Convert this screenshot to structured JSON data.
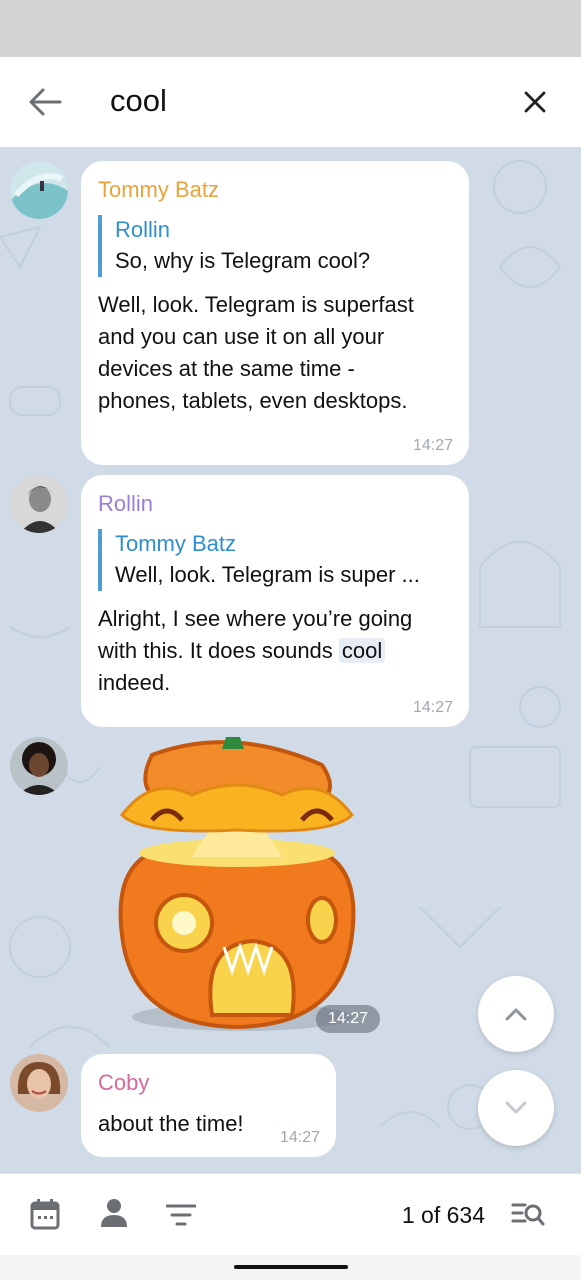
{
  "search": {
    "query": "cool"
  },
  "messages": [
    {
      "sender": "Tommy Batz",
      "sender_color": "#e9a33a",
      "reply_to": {
        "name": "Rollin",
        "text": "So, why is Telegram cool?"
      },
      "text_lines": [
        "Well, look. Telegram is superfast",
        "and you can use it on all your",
        "devices at the same time -",
        "phones, tablets, even desktops."
      ],
      "time": "14:27"
    },
    {
      "sender": "Rollin",
      "sender_color": "#9b7fd4",
      "reply_to": {
        "name": "Tommy Batz",
        "text": "Well, look. Telegram is super ..."
      },
      "text_before": "Alright, I see where you’re going",
      "text_mid": "with this. It does sounds ",
      "highlight": "cool",
      "text_after": "indeed.",
      "time": "14:27"
    },
    {
      "sticker": "pumpkin-sticker",
      "time": "14:27"
    },
    {
      "sender": "Coby",
      "sender_color": "#d66a9a",
      "text": "about the time!",
      "time": "14:27"
    }
  ],
  "bottom_bar": {
    "counter": "1 of 634",
    "icons": [
      "calendar-icon",
      "person-icon",
      "filter-icon",
      "list-search-icon"
    ]
  },
  "colors": {
    "accent": "#2e8fd0",
    "chat_background": "#d0dbe7"
  }
}
